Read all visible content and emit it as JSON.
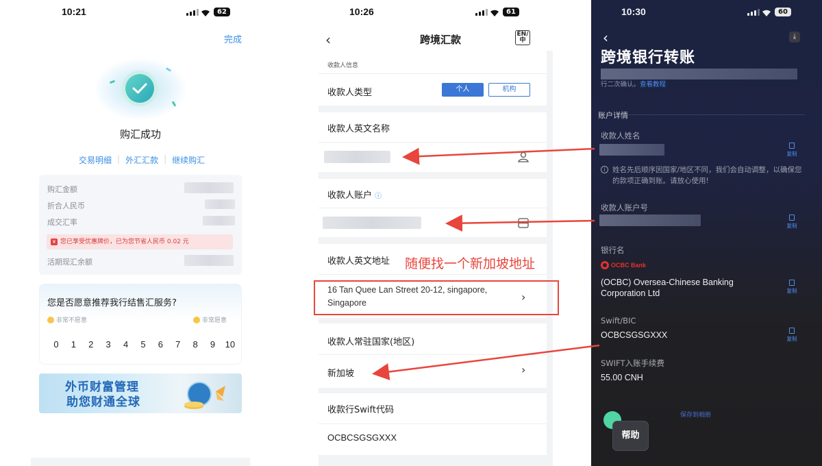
{
  "screen1": {
    "time": "10:21",
    "battery": "62",
    "done_label": "完成",
    "success_title": "购汇成功",
    "links": [
      "交易明细",
      "外汇汇款",
      "继续购汇"
    ],
    "rows": [
      "购汇金额",
      "折合人民币",
      "成交汇率",
      "活期现汇余额"
    ],
    "notice": "您已享受优惠牌价，已为您节省人民币 0.02 元",
    "survey_question": "您是否愿意推荐我行结售汇服务?",
    "survey_low": "非常不愿意",
    "survey_high": "非常愿意",
    "scale": [
      "0",
      "1",
      "2",
      "3",
      "4",
      "5",
      "6",
      "7",
      "8",
      "9",
      "10"
    ],
    "banner_line1": "外币财富管理",
    "banner_line2": "助您财通全球"
  },
  "screen2": {
    "time": "10:26",
    "battery": "61",
    "title": "跨境汇款",
    "lang_icon": "EN/中",
    "section_label": "收款人信息",
    "payee_type_label": "收款人类型",
    "type_personal": "个人",
    "type_org": "机构",
    "name_label": "收款人英文名称",
    "account_label": "收款人账户",
    "address_label": "收款人英文地址",
    "address_value": "16 Tan Quee Lan Street 20-12, singapore, Singapore",
    "country_label": "收款人常驻国家(地区)",
    "country_value": "新加坡",
    "swift_label": "收款行Swift代码",
    "swift_value": "OCBCSGSGXXX",
    "annotation": "随便找一个新加坡地址"
  },
  "screen3": {
    "time": "10:30",
    "battery": "60",
    "title": "跨境银行转账",
    "hint_prefix": "行二次确认。",
    "hint_link": "查看教程",
    "section": "账户详情",
    "name_label": "收款人姓名",
    "copy_label": "复制",
    "name_note": "姓名先后顺序因国家/地区不同，我们会自动调整，以确保您的款项正确到账。请放心使用!",
    "account_label": "收款人账户号",
    "bank_label": "银行名",
    "bank_logo_text": "OCBC Bank",
    "bank_value": "(OCBC) Oversea-Chinese Banking Corporation Ltd",
    "swift_label": "Swift/BIC",
    "swift_value": "OCBCSGSGXXX",
    "fee_label": "SWIFT入账手续费",
    "fee_value": "55.00 CNH",
    "help_label": "帮助",
    "cut_link": "保存到相册"
  },
  "colors": {
    "accent_blue": "#3a8ee6",
    "annotation_red": "#e8453c",
    "dark_bg": "#1e2342"
  }
}
